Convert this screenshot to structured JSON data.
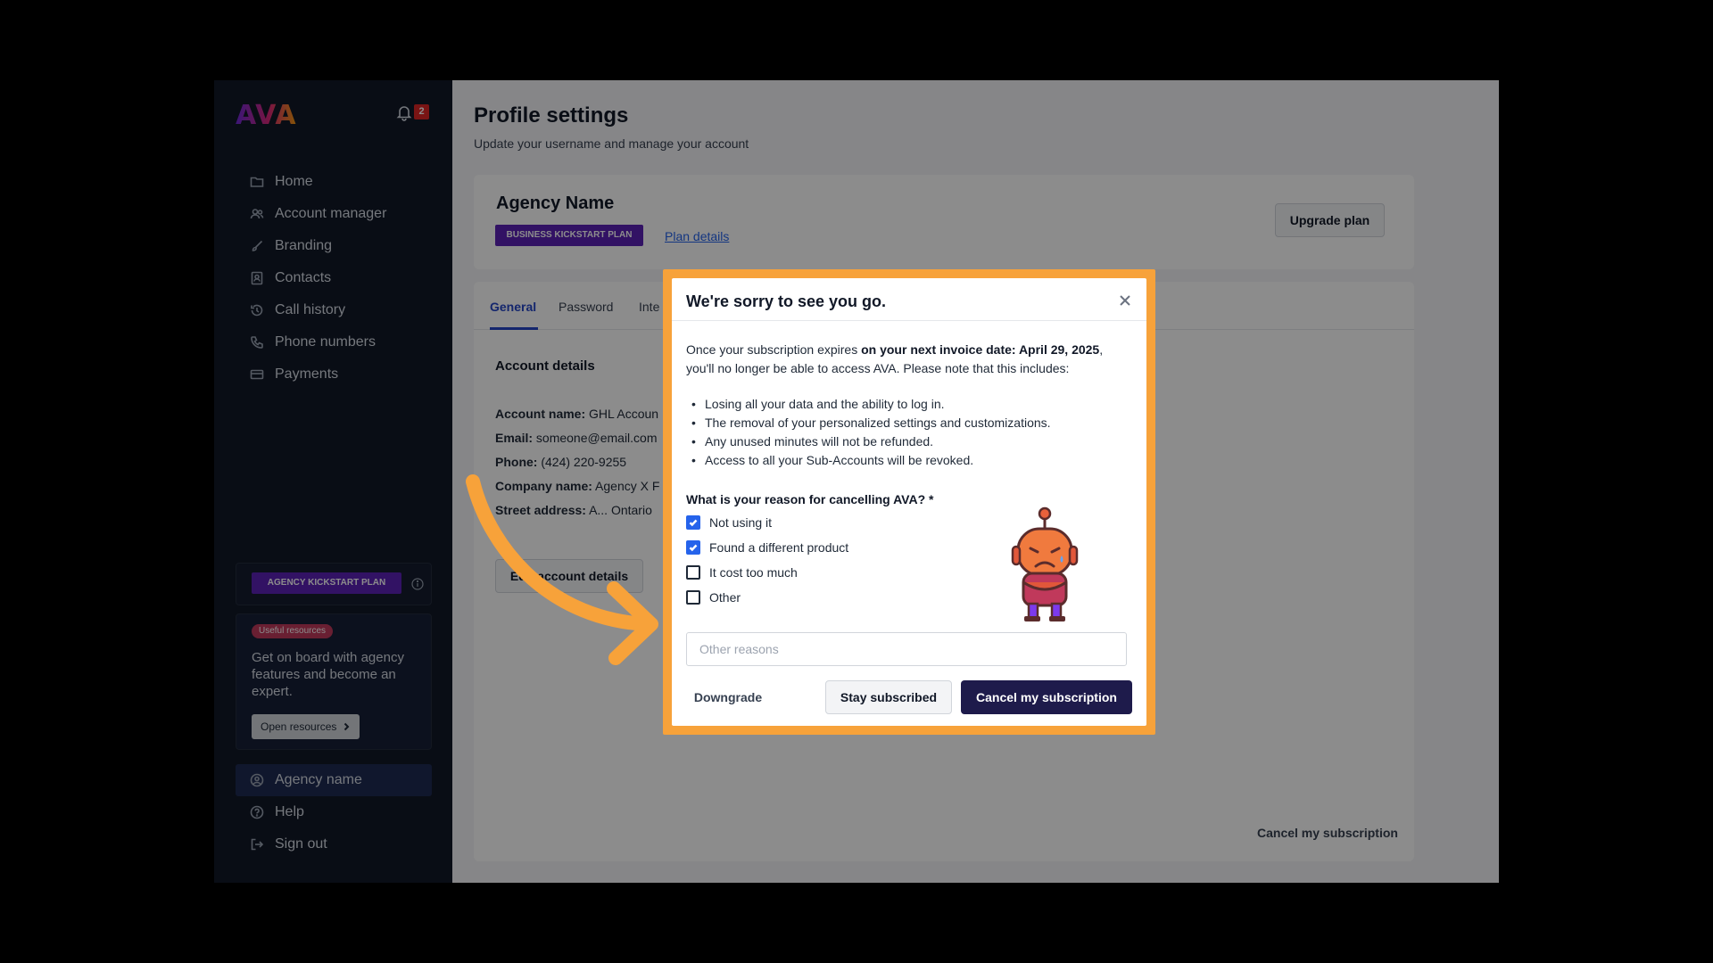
{
  "sidebar": {
    "logo": "AVA",
    "notification_count": "2",
    "nav": [
      {
        "label": "Home",
        "icon": "folder-icon"
      },
      {
        "label": "Account manager",
        "icon": "users-icon"
      },
      {
        "label": "Branding",
        "icon": "brush-icon"
      },
      {
        "label": "Contacts",
        "icon": "contact-book-icon"
      },
      {
        "label": "Call history",
        "icon": "history-icon"
      },
      {
        "label": "Phone numbers",
        "icon": "phone-icon"
      },
      {
        "label": "Payments",
        "icon": "card-icon"
      }
    ],
    "plan_badge": "AGENCY KICKSTART PLAN",
    "resources": {
      "chip": "Useful resources",
      "text": "Get on board with agency features and become an expert.",
      "button": "Open resources"
    },
    "bottom_nav": [
      {
        "label": "Agency name",
        "icon": "user-circle-icon"
      },
      {
        "label": "Help",
        "icon": "help-icon"
      },
      {
        "label": "Sign out",
        "icon": "sign-out-icon"
      }
    ]
  },
  "main": {
    "title": "Profile settings",
    "subtitle": "Update your username and manage your account",
    "agency": {
      "name": "Agency Name",
      "plan_badge": "BUSINESS KICKSTART PLAN",
      "plan_link": "Plan details",
      "upgrade_button": "Upgrade plan"
    },
    "tabs": [
      "General",
      "Password",
      "Inte"
    ],
    "account_details": {
      "title": "Account details",
      "rows": [
        {
          "label": "Account name:",
          "value": "GHL Accoun"
        },
        {
          "label": "Email:",
          "value": "someone@email.com"
        },
        {
          "label": "Phone:",
          "value": "(424) 220-9255"
        },
        {
          "label": "Company name:",
          "value": "Agency X F"
        },
        {
          "label": "Street address:",
          "value": "A... Ontario"
        }
      ],
      "edit_button": "Edit account details"
    },
    "cancel_link": "Cancel my subscription"
  },
  "modal": {
    "title": "We're sorry to see you go.",
    "intro_prefix": "Once your subscription expires ",
    "intro_bold": "on your next invoice date: April 29, 2025",
    "intro_suffix": ", you'll no longer be able to access AVA. Please note that this includes:",
    "bullets": [
      "Losing all your data and the ability to log in.",
      "The removal of your personalized settings and customizations.",
      "Any unused minutes will not be refunded.",
      "Access to all your Sub-Accounts will be revoked."
    ],
    "question": "What is your reason for cancelling AVA? *",
    "reasons": [
      {
        "label": "Not using it",
        "checked": true
      },
      {
        "label": "Found a different product",
        "checked": true
      },
      {
        "label": "It cost too much",
        "checked": false
      },
      {
        "label": "Other",
        "checked": false
      }
    ],
    "other_placeholder": "Other reasons",
    "downgrade_button": "Downgrade",
    "stay_button": "Stay subscribed",
    "cancel_button": "Cancel my subscription"
  },
  "colors": {
    "highlight_frame": "#f7a23a",
    "primary_dark": "#1e1b4b",
    "plan_purple": "#5b21b6",
    "checkbox_blue": "#2563eb",
    "sidebar_bg": "#111827"
  }
}
